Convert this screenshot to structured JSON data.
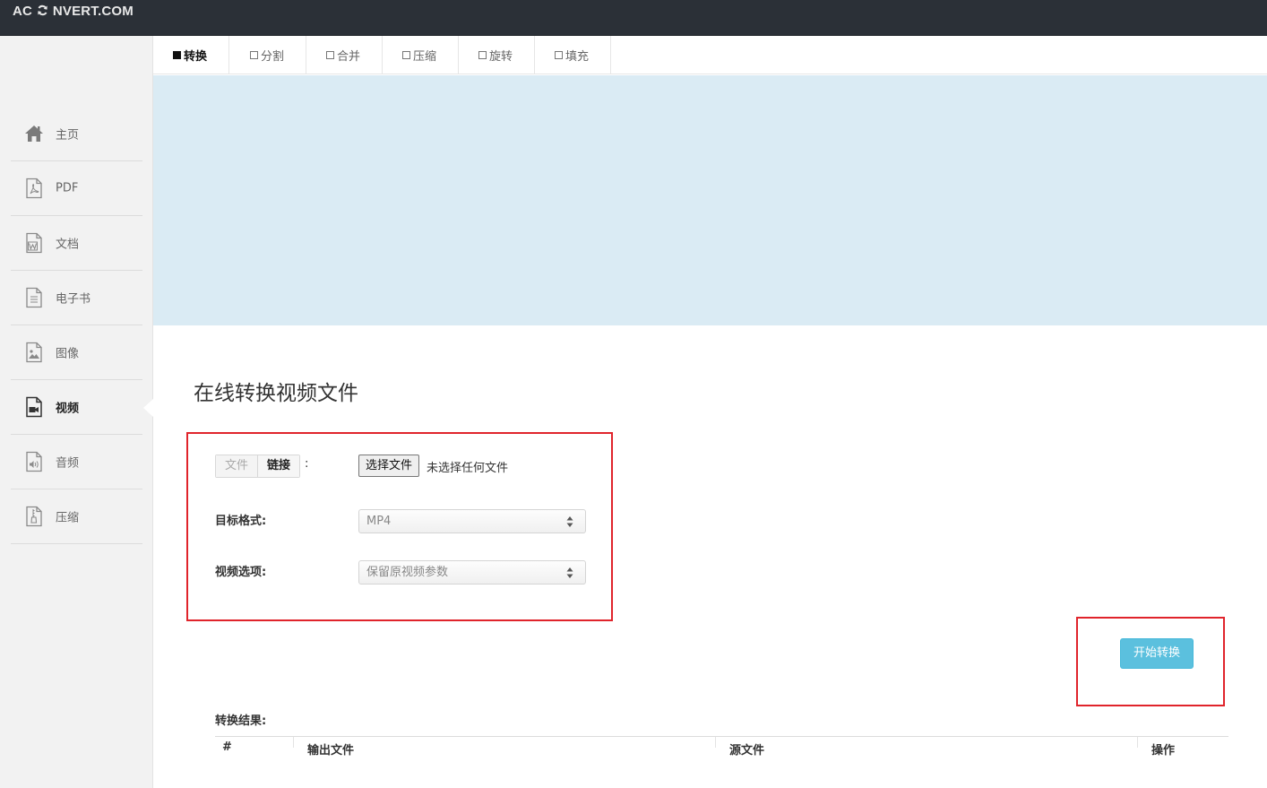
{
  "header": {
    "logo_prefix": "AC",
    "logo_suffix": "NVERT.COM"
  },
  "sidebar": {
    "items": [
      {
        "label": "主页",
        "icon": "home-icon"
      },
      {
        "label": "PDF",
        "icon": "pdf-file-icon"
      },
      {
        "label": "文档",
        "icon": "word-file-icon"
      },
      {
        "label": "电子书",
        "icon": "ebook-file-icon"
      },
      {
        "label": "图像",
        "icon": "image-file-icon"
      },
      {
        "label": "视频",
        "icon": "video-file-icon",
        "active": true
      },
      {
        "label": "音频",
        "icon": "audio-file-icon"
      },
      {
        "label": "压缩",
        "icon": "archive-file-icon"
      }
    ]
  },
  "tabs": [
    {
      "label": "转换",
      "active": true
    },
    {
      "label": "分割"
    },
    {
      "label": "合并"
    },
    {
      "label": "压缩"
    },
    {
      "label": "旋转"
    },
    {
      "label": "填充"
    }
  ],
  "main": {
    "title": "在线转换视频文件",
    "source_toggle": {
      "file": "文件",
      "link": "链接",
      "colon": ":"
    },
    "file_input": {
      "button": "选择文件",
      "status": "未选择任何文件"
    },
    "target_format": {
      "label": "目标格式:",
      "value": "MP4"
    },
    "video_options": {
      "label": "视频选项:",
      "value": "保留原视频参数"
    },
    "start_button": "开始转换",
    "results": {
      "label": "转换结果:",
      "columns": [
        "#",
        "输出文件",
        "源文件",
        "操作"
      ]
    }
  },
  "colors": {
    "topbar": "#2b3037",
    "banner": "#daebf4",
    "highlight": "#e0242b",
    "primary_button": "#5bc0de"
  }
}
